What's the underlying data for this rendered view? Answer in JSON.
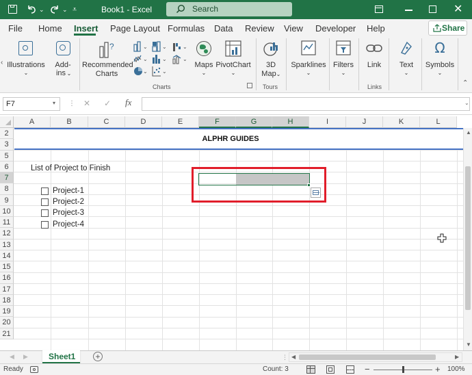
{
  "titlebar": {
    "doc_title": "Book1 - Excel",
    "search_placeholder": "Search"
  },
  "menu": {
    "items": [
      "File",
      "Home",
      "Insert",
      "Page Layout",
      "Formulas",
      "Data",
      "Review",
      "View",
      "Developer",
      "Help"
    ],
    "active": "Insert",
    "share_label": "Share"
  },
  "ribbon": {
    "illustrations": "Illustrations",
    "addins_line1": "Add-",
    "addins_line2": "ins",
    "rec_charts_line1": "Recommended",
    "rec_charts_line2": "Charts",
    "maps": "Maps",
    "pivotchart": "PivotChart",
    "map3d_line1": "3D",
    "map3d_line2": "Map",
    "sparklines": "Sparklines",
    "filters": "Filters",
    "link": "Link",
    "text": "Text",
    "symbols": "Symbols",
    "group_charts": "Charts",
    "group_tours": "Tours",
    "group_links": "Links"
  },
  "formulabar": {
    "namebox": "F7",
    "formula": ""
  },
  "grid": {
    "columns": [
      "A",
      "B",
      "C",
      "D",
      "E",
      "F",
      "G",
      "H",
      "I",
      "J",
      "K",
      "L"
    ],
    "selected_columns": [
      "F",
      "G",
      "H"
    ],
    "rows": [
      "2",
      "3",
      "5",
      "6",
      "7",
      "8",
      "9",
      "10",
      "11",
      "12",
      "13",
      "14",
      "15",
      "16",
      "17",
      "18",
      "19",
      "20",
      "21"
    ],
    "title": "ALPHR GUIDES",
    "list_heading": "List of Project to Finish",
    "projects": [
      "Project-1",
      "Project-2",
      "Project-3",
      "Project-4"
    ]
  },
  "sheets": {
    "tabs": [
      "Sheet1"
    ]
  },
  "status": {
    "ready": "Ready",
    "count": "Count: 3",
    "zoom": "100%"
  },
  "colors": {
    "brand": "#217346",
    "highlight_box": "#e11d2a"
  }
}
